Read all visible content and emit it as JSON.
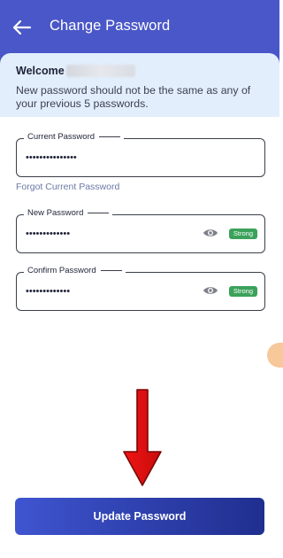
{
  "header": {
    "title": "Change Password",
    "back_icon": "arrow-left-icon",
    "background": "#4a57c8"
  },
  "info": {
    "welcome": "Welcome",
    "message": "New password should not be the same as any of your previous 5 passwords."
  },
  "fields": {
    "current": {
      "label": "Current Password",
      "value": "•••••••••••••••"
    },
    "new": {
      "label": "New Password",
      "value": "•••••••••••••",
      "strength": "Strong",
      "eye_icon": "eye-icon"
    },
    "confirm": {
      "label": "Confirm Password",
      "value": "•••••••••••••",
      "strength": "Strong",
      "eye_icon": "eye-icon"
    }
  },
  "forgot_link": "Forgot Current Password",
  "update_button": "Update Password",
  "annotation": {
    "arrow_color": "#e01010",
    "arrow_icon": "arrow-down-icon"
  },
  "colors": {
    "badge": "#3aa25a",
    "button": "#2c3da8",
    "info_bg": "#e3eefc"
  }
}
